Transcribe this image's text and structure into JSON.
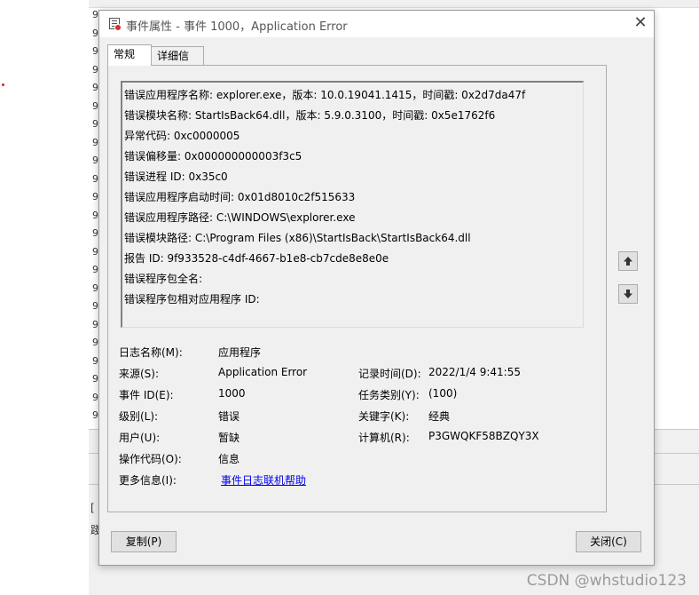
{
  "background": {
    "row_marks": [
      "9",
      "9",
      "9",
      "9",
      "9",
      "9",
      "9",
      "9",
      "9",
      "9",
      "9",
      "9",
      "9",
      "9",
      "9",
      "9",
      "9",
      "9",
      "9",
      "9",
      "9",
      "9",
      "9"
    ],
    "stub_char_1": "[",
    "stub_char_2": "踐"
  },
  "watermark": "CSDN @whstudio123",
  "dialog": {
    "title": "事件属性 - 事件 1000，Application Error",
    "close_glyph": "✕",
    "tabs": [
      "常规",
      "详细信息"
    ],
    "description_lines": [
      "错误应用程序名称: explorer.exe，版本: 10.0.19041.1415，时间戳: 0x2d7da47f",
      "错误模块名称: StartIsBack64.dll，版本: 5.9.0.3100，时间戳: 0x5e1762f6",
      "异常代码: 0xc0000005",
      "错误偏移量: 0x000000000003f3c5",
      "错误进程 ID: 0x35c0",
      "错误应用程序启动时间: 0x01d8010c2f515633",
      "错误应用程序路径: C:\\WINDOWS\\explorer.exe",
      "错误模块路径: C:\\Program Files (x86)\\StartIsBack\\StartIsBack64.dll",
      "报告 ID: 9f933528-c4df-4667-b1e8-cb7cde8e8e0e",
      "错误程序包全名:",
      "错误程序包相对应用程序 ID:"
    ],
    "fields": {
      "log_name": {
        "label": "日志名称(M):",
        "value": "应用程序"
      },
      "source": {
        "label": "来源(S):",
        "value": "Application Error"
      },
      "logged": {
        "label": "记录时间(D):",
        "value": "2022/1/4 9:41:55"
      },
      "event_id": {
        "label": "事件 ID(E):",
        "value": "1000"
      },
      "task_category": {
        "label": "任务类别(Y):",
        "value": "(100)"
      },
      "level": {
        "label": "级别(L):",
        "value": "错误"
      },
      "keywords": {
        "label": "关键字(K):",
        "value": "经典"
      },
      "user": {
        "label": "用户(U):",
        "value": "暂缺"
      },
      "computer": {
        "label": "计算机(R):",
        "value": "P3GWQKF58BZQY3X"
      },
      "opcode": {
        "label": "操作代码(O):",
        "value": "信息"
      },
      "more_info": {
        "label": "更多信息(I):",
        "value": "事件日志联机帮助"
      }
    },
    "buttons": {
      "copy": "复制(P)",
      "close": "关闭(C)",
      "up_icon": "arrow-up-icon",
      "down_icon": "arrow-down-icon"
    }
  }
}
